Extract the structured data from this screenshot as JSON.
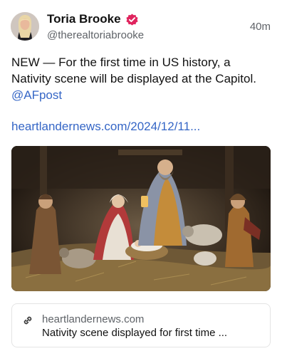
{
  "author": {
    "name": "Toria Brooke",
    "handle": "@therealtoriabrooke",
    "time": "40m"
  },
  "post": {
    "text": "NEW — For the first time in US history, a Nativity scene will be displayed at the Capitol.",
    "mention": "@AFpost",
    "link": "heartlandernews.com/2024/12/11..."
  },
  "link_card": {
    "icon": "link-icon",
    "domain": "heartlandernews.com",
    "title": "Nativity scene displayed for first time ..."
  },
  "colors": {
    "link": "#3566c6",
    "verified_badge": "#e0245e",
    "secondary_text": "#5f6368"
  }
}
